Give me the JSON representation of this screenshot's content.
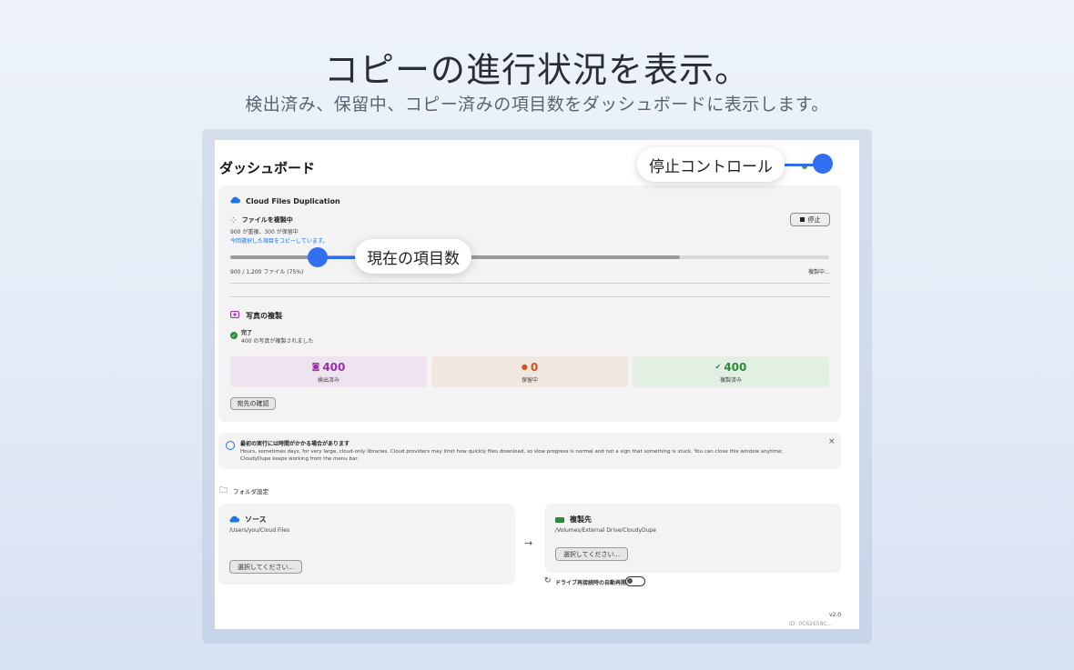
{
  "hero": {
    "title": "コピーの進行状況を表示。",
    "subtitle": "検出済み、保留中、コピー済みの項目数をダッシュボードに表示します。"
  },
  "window": {
    "title": "ダッシュボード"
  },
  "callouts": {
    "stop_control": "停止コントロール",
    "current_items": "現在の項目数"
  },
  "cloud_section": {
    "title": "Cloud Files Duplication",
    "status": "ファイルを複製中",
    "counts_line": "900 が重複、300 が保留中",
    "copy_note": "今回選択した項目をコピーしています。",
    "stop_label": "停止",
    "progress_text": "900 / 1,200 ファイル (75%)",
    "progress_fraction": 0.75,
    "progress_state": "複製中..."
  },
  "photo_section": {
    "title": "写真の複製",
    "status": "完了",
    "detail": "400 の写真が複製されました",
    "stats": [
      {
        "value": "400",
        "label": "検出済み",
        "color": "#9b2fae",
        "bg": "#efe3ef"
      },
      {
        "value": "0",
        "label": "保留中",
        "color": "#d6501d",
        "bg": "#f1e7e1"
      },
      {
        "value": "400",
        "label": "複製済み",
        "color": "#2e8a3c",
        "bg": "#e2efe3"
      }
    ],
    "confirm_button": "宛先の確認"
  },
  "notice": {
    "title": "最初の実行には時間がかかる場合があります",
    "body_line1": "Hours, sometimes days, for very large, cloud-only libraries. Cloud providers may limit how quickly files download, so slow progress is normal and not a sign that something is stuck. You can close this window anytime;",
    "body_line2": "CloudyDupe keeps working from the menu bar.",
    "close": "×"
  },
  "folder_settings": {
    "label": "フォルダ設定",
    "source": {
      "title": "ソース",
      "path": "/Users/you/Cloud Files",
      "button": "選択してください..."
    },
    "arrow": "→",
    "destination": {
      "title": "複製先",
      "path": "/Volumes/External Drive/CloudyDupe",
      "button": "選択してください..."
    },
    "auto_resume": "ドライブ再接続時の自動再開",
    "auto_resume_on": false
  },
  "footer": {
    "version": "v2.0",
    "id": "ID: 0C62658C..."
  },
  "colors": {
    "accent": "#2f6ff0",
    "cloud_icon": "#1a73e8",
    "success": "#2e8a3c"
  }
}
